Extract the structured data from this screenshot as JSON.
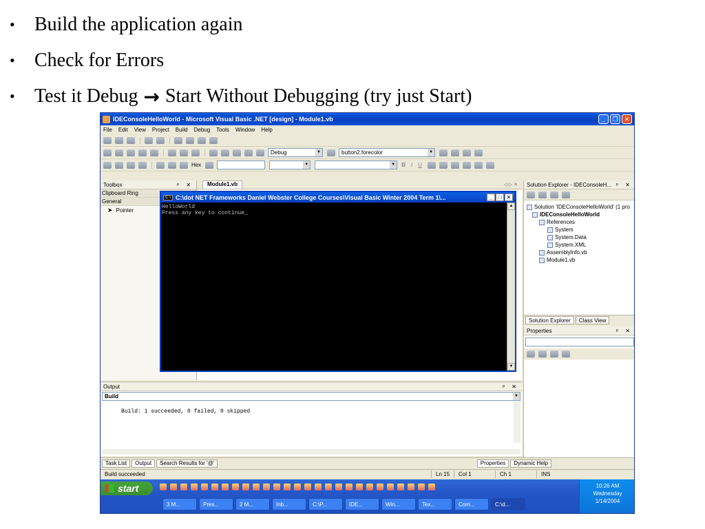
{
  "slide": {
    "bullets": [
      {
        "text": "Build the application again"
      },
      {
        "text": "Check for Errors"
      },
      {
        "before": "Test it Debug",
        "arrow": "→",
        "after": "Start Without Debugging (try just Start)"
      }
    ]
  },
  "ide": {
    "title": "IDEConsoleHelloWorld - Microsoft Visual Basic .NET [design] - Module1.vb",
    "menu": [
      "File",
      "Edit",
      "View",
      "Project",
      "Build",
      "Debug",
      "Tools",
      "Window",
      "Help"
    ],
    "config_combo": "Debug",
    "find_combo": "button2.forecolor",
    "hex_label": "Hex",
    "toolbox": {
      "header": "Toolbox",
      "sections": [
        "Clipboard Ring",
        "General"
      ],
      "items": [
        "Pointer"
      ]
    },
    "editor_tab": "Module1.vb",
    "console": {
      "title": "C:\\dot NET Frameworks Daniel Webster College Courses\\Visual Basic Winter 2004 Term 1\\...",
      "lines": [
        "HelloWorld",
        "Press any key to continue_"
      ]
    },
    "solution_explorer": {
      "header": "Solution Explorer - IDEConsoleH...",
      "tree": [
        {
          "label": "Solution 'IDEConsoleHelloWorld' (1 pro",
          "indent": 0
        },
        {
          "label": "IDEConsoleHelloWorld",
          "indent": 1,
          "bold": true
        },
        {
          "label": "References",
          "indent": 2
        },
        {
          "label": "System",
          "indent": 3
        },
        {
          "label": "System.Data",
          "indent": 3
        },
        {
          "label": "System.XML",
          "indent": 3
        },
        {
          "label": "AssemblyInfo.vb",
          "indent": 2
        },
        {
          "label": "Module1.vb",
          "indent": 2
        }
      ],
      "tabs": [
        "Solution Explorer",
        "Class View"
      ]
    },
    "properties": {
      "header": "Properties",
      "tabs": [
        "Properties",
        "Dynamic Help"
      ]
    },
    "output": {
      "header": "Output",
      "combo": "Build",
      "text": "Build: 1 succeeded, 0 failed, 0 skipped"
    },
    "bottom_tabs": [
      "Task List",
      "Output",
      "Search Results for '@'"
    ],
    "status": {
      "message": "Build succeeded",
      "ln": "Ln 15",
      "col": "Col 1",
      "ch": "Ch 1",
      "mode": "INS"
    }
  },
  "taskbar": {
    "start_label": "start",
    "tasks": [
      "3 M...",
      "Pres...",
      "2 M...",
      "Inb...",
      "C:\\P...",
      "IDE...",
      "Win...",
      "Tex...",
      "Com...",
      "C:\\d..."
    ],
    "time": "10:26 AM",
    "day": "Wednesday",
    "date": "1/14/2004"
  }
}
